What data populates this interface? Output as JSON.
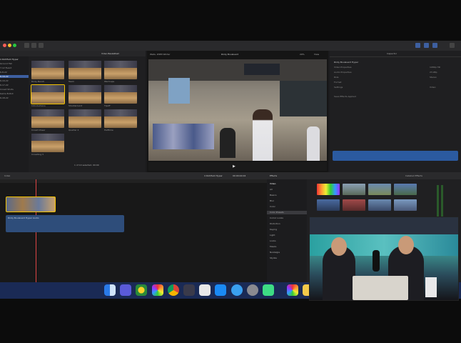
{
  "app": {
    "name": "Final Cut Pro",
    "browser_title": "Video Basketball",
    "viewer_title": "Wells, WDM Winter",
    "viewer_center": "Ricky Boulevard",
    "zoom": "29%",
    "view_label": "View"
  },
  "library": {
    "items": [
      "4 Richfield Hyper",
      "Ground Fall",
      "7-12 Event",
      "6-8-22",
      "6-19-22",
      "6-19-22",
      "6-17-22",
      "Crowd Shots",
      "Game B-Roll",
      "6-18-22"
    ]
  },
  "browser": {
    "thumbs": [
      {
        "label": "Ricky Bench"
      },
      {
        "label": "Team"
      },
      {
        "label": "Warmups"
      },
      {
        "label": "Introductions"
      },
      {
        "label": "Shootaround"
      },
      {
        "label": "Tipoff"
      },
      {
        "label": "Crowd Cheer"
      },
      {
        "label": "Quarter 2"
      },
      {
        "label": "Halftime"
      },
      {
        "label": "Crowding 3"
      }
    ],
    "footer": "1 of 10 selected, 00:00"
  },
  "inspector": {
    "title": "Inspector",
    "rows": [
      "Ricky Boulevard Hyper",
      "Video Properties",
      "Audio Properties",
      "Role",
      "Format",
      "Settings"
    ],
    "values": [
      "1080p HD",
      "23.98p",
      "Stereo",
      "Video"
    ],
    "note": "Save Effects Applied"
  },
  "timeline": {
    "index_label": "Index",
    "title": "4 Richfield Hyper",
    "timecode": "00:00:44:04",
    "audio_label": "Ricky Boulevard Hyper Audio"
  },
  "effects": {
    "title": "Effects",
    "header_right": "Installed Effects",
    "categories": [
      "Video",
      "All",
      "Basics",
      "Blur",
      "Color",
      "Color Presets",
      "Comic Looks",
      "Distortion",
      "Keying",
      "Light",
      "Looks",
      "Masks",
      "Nostalgia",
      "Stylize"
    ]
  },
  "dock": {
    "icons": [
      "finder-icon",
      "launchpad-icon",
      "games-icon",
      "photos-icon",
      "chrome-icon",
      "motion-icon",
      "final-cut-icon",
      "app-store-icon",
      "safari-icon",
      "settings-icon",
      "android-icon",
      "photos-alt-icon",
      "notes-icon"
    ]
  }
}
